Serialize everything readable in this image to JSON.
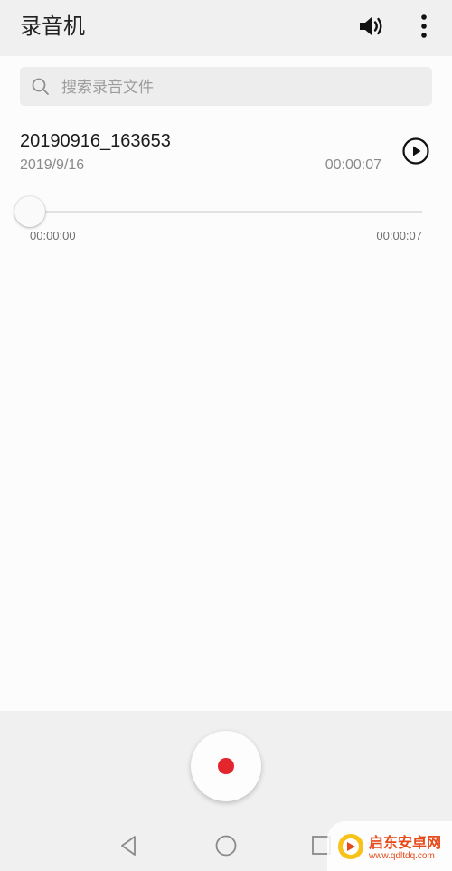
{
  "app": {
    "title": "录音机"
  },
  "toolbar": {
    "speaker_icon": "speaker-icon",
    "more_icon": "more-vert-icon"
  },
  "search": {
    "placeholder": "搜索录音文件",
    "value": ""
  },
  "recording": {
    "name": "20190916_163653",
    "date": "2019/9/16",
    "duration": "00:00:07",
    "progress": 0
  },
  "player": {
    "elapsed": "00:00:00",
    "total": "00:00:07"
  },
  "record_button": {
    "color": "#e3262b"
  },
  "navbar": {
    "icons": [
      "back-icon",
      "home-icon",
      "recent-apps-icon"
    ]
  },
  "watermark": {
    "name": "启东安卓网",
    "url": "www.qdltdq.com"
  }
}
